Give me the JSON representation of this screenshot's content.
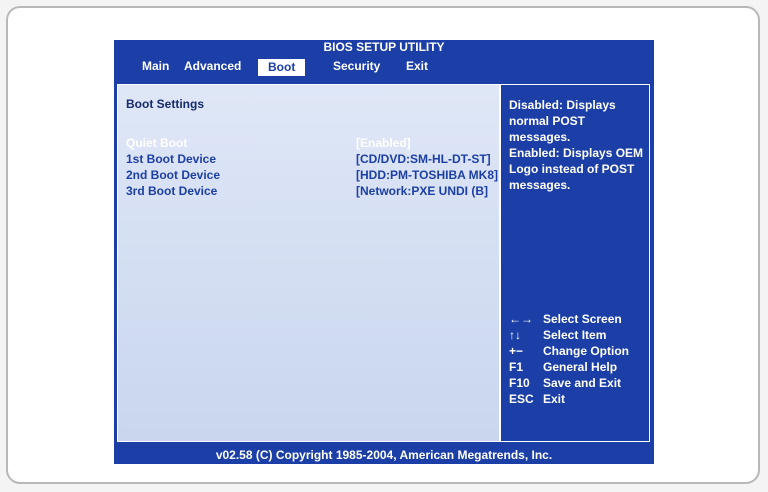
{
  "window": {
    "title": "BIOS SETUP UTILITY"
  },
  "menu": {
    "items": [
      "Main",
      "Advanced",
      "Boot",
      "Security",
      "Exit"
    ],
    "active": "Boot"
  },
  "boot_settings": {
    "section_title": "Boot Settings",
    "rows": [
      {
        "label": "Quiet Boot",
        "value": "[Enabled]"
      },
      {
        "label": "1st Boot Device",
        "value": "[CD/DVD:SM-HL-DT-ST]"
      },
      {
        "label": "2nd Boot Device",
        "value": "[HDD:PM-TOSHIBA MK8]"
      },
      {
        "label": "3rd Boot Device",
        "value": "[Network:PXE UNDI (B]"
      }
    ]
  },
  "help": {
    "lines": [
      "Disabled: Displays",
      "normal POST messages.",
      "Enabled: Displays OEM",
      "Logo instead of POST",
      "messages."
    ]
  },
  "keys": [
    {
      "key": "←→",
      "action": "Select Screen"
    },
    {
      "key": "↑↓",
      "action": "Select Item"
    },
    {
      "key": "+−",
      "action": "Change Option"
    },
    {
      "key": "F1",
      "action": "General Help"
    },
    {
      "key": "F10",
      "action": "Save and Exit"
    },
    {
      "key": "ESC",
      "action": "Exit"
    }
  ],
  "footer": {
    "text": "v02.58 (C) Copyright  1985-2004, American Megatrends, Inc."
  },
  "colors": {
    "bios_blue": "#1c3fa7",
    "panel_light": "#dfe7f7",
    "text_white": "#ffffff"
  }
}
